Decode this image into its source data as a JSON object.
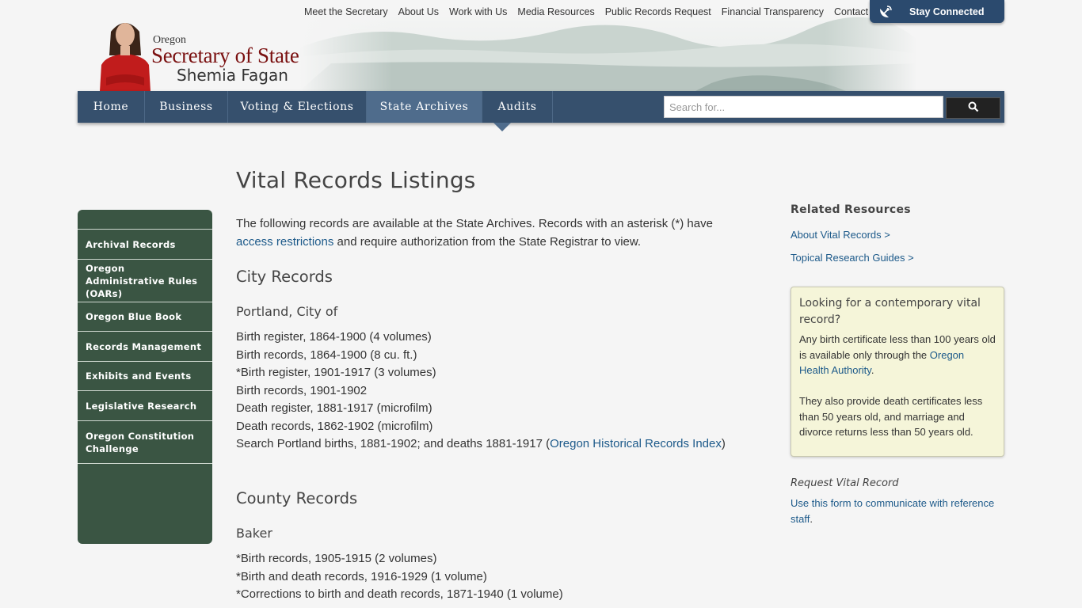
{
  "header": {
    "logo": {
      "state": "Oregon",
      "office": "Secretary of State",
      "official": "Shemia Fagan"
    },
    "utility_nav": [
      "Meet the Secretary",
      "About Us",
      "Work with Us",
      "Media Resources",
      "Public Records Request",
      "Financial Transparency",
      "Contact Us"
    ],
    "stay_connected": {
      "label": "Stay Connected",
      "icon": "satellite-dish-icon"
    }
  },
  "main_nav": {
    "items": [
      "Home",
      "Business",
      "Voting & Elections",
      "State Archives",
      "Audits"
    ],
    "active": "State Archives",
    "search": {
      "placeholder": "Search for...",
      "button_icon": "search-icon"
    }
  },
  "left_sidebar": {
    "items": [
      "Archival Records",
      "Oregon Administrative Rules (OARs)",
      "Oregon Blue Book",
      "Records Management",
      "Exhibits and Events",
      "Legislative Research",
      "Oregon Constitution Challenge"
    ]
  },
  "content": {
    "title": "Vital Records Listings",
    "intro_before": " The following records are available at the State Archives. Records with an asterisk (*) have ",
    "intro_link": "access restrictions",
    "intro_after": " and require authorization from the State Registrar to view.",
    "city_heading": "City Records",
    "portland": {
      "heading": "Portland, City of",
      "records": [
        "Birth register, 1864-1900 (4 volumes)",
        "Birth records, 1864-1900 (8 cu. ft.)",
        "*Birth register, 1901-1917 (3 volumes)",
        "Birth records, 1901-1902",
        "Death register, 1881-1917 (microfilm)",
        "Death records, 1862-1902 (microfilm)"
      ],
      "search_before": "Search Portland births, 1881-1902; and deaths 1881-1917 (",
      "search_link": "Oregon Historical Records Index",
      "search_after": ")"
    },
    "county_heading": "County Records",
    "baker": {
      "heading": "Baker",
      "records": [
        "*Birth records, 1905-1915 (2 volumes)",
        "*Birth and death records, 1916-1929 (1 volume)",
        "*Corrections to birth and death records, 1871-1940 (1 volume)"
      ]
    }
  },
  "right_sidebar": {
    "related_title": "Related Resources",
    "links": [
      "About Vital Records >",
      "Topical Research Guides >"
    ],
    "callout": {
      "title": "Looking for a contemporary vital record?",
      "p1_before": "Any birth certificate less than 100 years old is available only through the ",
      "p1_link": "Oregon Health Authority",
      "p1_after": ".",
      "p2": "They also provide death certificates less than 50 years old, and marriage and divorce returns less than 50 years old."
    },
    "request": {
      "title": "Request Vital Record",
      "link": "Use this form to communicate with reference staff",
      "after": "."
    }
  },
  "colors": {
    "nav_bg": "#36506d",
    "nav_active": "#4f6c8c",
    "sidebar_bg": "#3a5543",
    "link": "#1d5a8a",
    "callout_bg": "#f5f5d9",
    "brand_red": "#7a1010"
  }
}
